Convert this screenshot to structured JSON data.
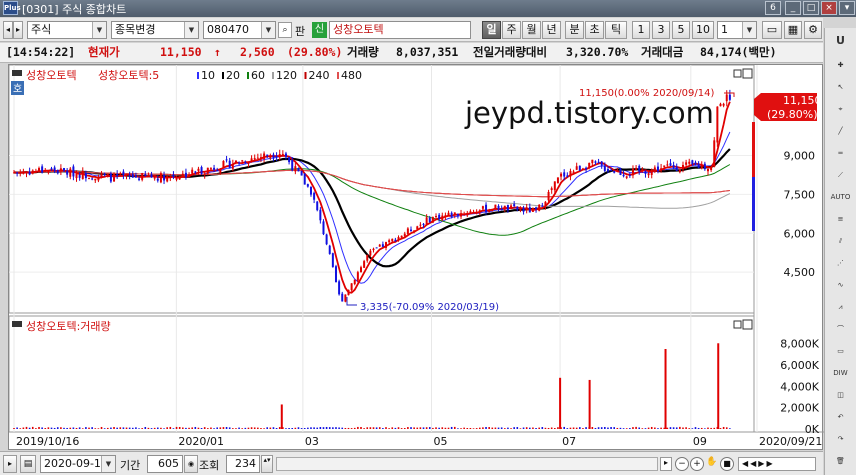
{
  "titlebar": {
    "app_icon": "Plus",
    "title": "[0301] 주식 종합차트",
    "buttons": [
      "6",
      "_",
      "□",
      "×"
    ]
  },
  "toolbar": {
    "market": "주식",
    "mode": "종목변경",
    "code": "080470",
    "pan_label": "판",
    "badge": "신",
    "stock_name": "성창오토텍",
    "periods": [
      "일",
      "주",
      "월",
      "년",
      "분",
      "초",
      "틱"
    ],
    "selected_period": "일",
    "numbers": [
      "1",
      "3",
      "5",
      "10"
    ],
    "interval": "1"
  },
  "quotebar": {
    "time": "[14:54:22]",
    "price_label": "현재가",
    "price": "11,150",
    "arrow": "↑",
    "change": "2,560",
    "change_pct": "(29.80%)",
    "volume_label": "거래량",
    "volume": "8,037,351",
    "prev_ratio_label": "전일거래량대비",
    "prev_ratio": "3,320.70%",
    "amount_label": "거래대금",
    "amount": "84,174(백만)"
  },
  "price_panel": {
    "legend_name": "성창오토텍",
    "ma_prefix": "성창오토텍:5",
    "ma_items": [
      "10",
      "20",
      "60",
      "120",
      "240",
      "480"
    ],
    "ma_colors": [
      "#e00000",
      "#3030ff",
      "#000000",
      "#108010",
      "#a0a0a0",
      "#c00000",
      "#e05050"
    ],
    "side_label": "호",
    "high_annotation": "11,150(0.00% 2020/09/14)",
    "low_annotation": "3,335(-70.09% 2020/03/19)",
    "watermark": "jeypd.tistory.com",
    "price_tag": "11,150",
    "pct_tag": "29.80%"
  },
  "volume_panel": {
    "legend": "성창오토텍:거래량"
  },
  "x_axis": {
    "labels": [
      "2019/10/16",
      "2020/01",
      "03",
      "05",
      "07",
      "09",
      "2020/09/21"
    ]
  },
  "bottombar": {
    "date": "2020-09-14",
    "period_label": "기간",
    "period_value": "605",
    "lookup_label": "조회",
    "count": "234"
  },
  "chart_data": [
    {
      "type": "candlestick",
      "title": "성창오토텍",
      "y_ticks": [
        4500,
        6000,
        7500,
        9000
      ],
      "ylim": [
        3000,
        11800
      ],
      "x_ticks": [
        "2019/10/16",
        "2020/01",
        "03",
        "05",
        "07",
        "09",
        "2020/09/21"
      ],
      "close_path": [
        {
          "date": "2019/10/16",
          "close": 8350
        },
        {
          "date": "2019/11",
          "close": 8450
        },
        {
          "date": "2019/12",
          "close": 8150
        },
        {
          "date": "2020/01",
          "close": 8200
        },
        {
          "date": "2020/02",
          "close": 8800
        },
        {
          "date": "2020/02/20",
          "close": 9150
        },
        {
          "date": "2020/03/05",
          "close": 7600
        },
        {
          "date": "2020/03/12",
          "close": 5700
        },
        {
          "date": "2020/03/19",
          "close": 3335
        },
        {
          "date": "2020/04",
          "close": 5200
        },
        {
          "date": "2020/05",
          "close": 6600
        },
        {
          "date": "2020/06",
          "close": 7000
        },
        {
          "date": "2020/06/20",
          "close": 6850
        },
        {
          "date": "2020/07",
          "close": 8200
        },
        {
          "date": "2020/07/15",
          "close": 8700
        },
        {
          "date": "2020/08",
          "close": 8300
        },
        {
          "date": "2020/08/20",
          "close": 8550
        },
        {
          "date": "2020/09/01",
          "close": 8600
        },
        {
          "date": "2020/09/11",
          "close": 8590
        },
        {
          "date": "2020/09/14",
          "close": 11150
        }
      ],
      "annotations": [
        {
          "text": "11,150(0.00% 2020/09/14)",
          "date": "2020/09/14",
          "value": 11150
        },
        {
          "text": "3,335(-70.09% 2020/03/19)",
          "date": "2020/03/19",
          "value": 3335
        }
      ]
    },
    {
      "type": "bar",
      "title": "성창오토텍:거래량",
      "y_ticks": [
        "0K",
        "2,000K",
        "4,000K",
        "6,000K",
        "8,000K"
      ],
      "ylim": [
        0,
        9000
      ],
      "notable_bars": [
        {
          "date": "2020/02/20",
          "value": 2300
        },
        {
          "date": "2020/07/01",
          "value": 4800
        },
        {
          "date": "2020/07/15",
          "value": 4600
        },
        {
          "date": "2020/08/20",
          "value": 7500
        },
        {
          "date": "2020/09/14",
          "value": 8037
        }
      ]
    }
  ]
}
